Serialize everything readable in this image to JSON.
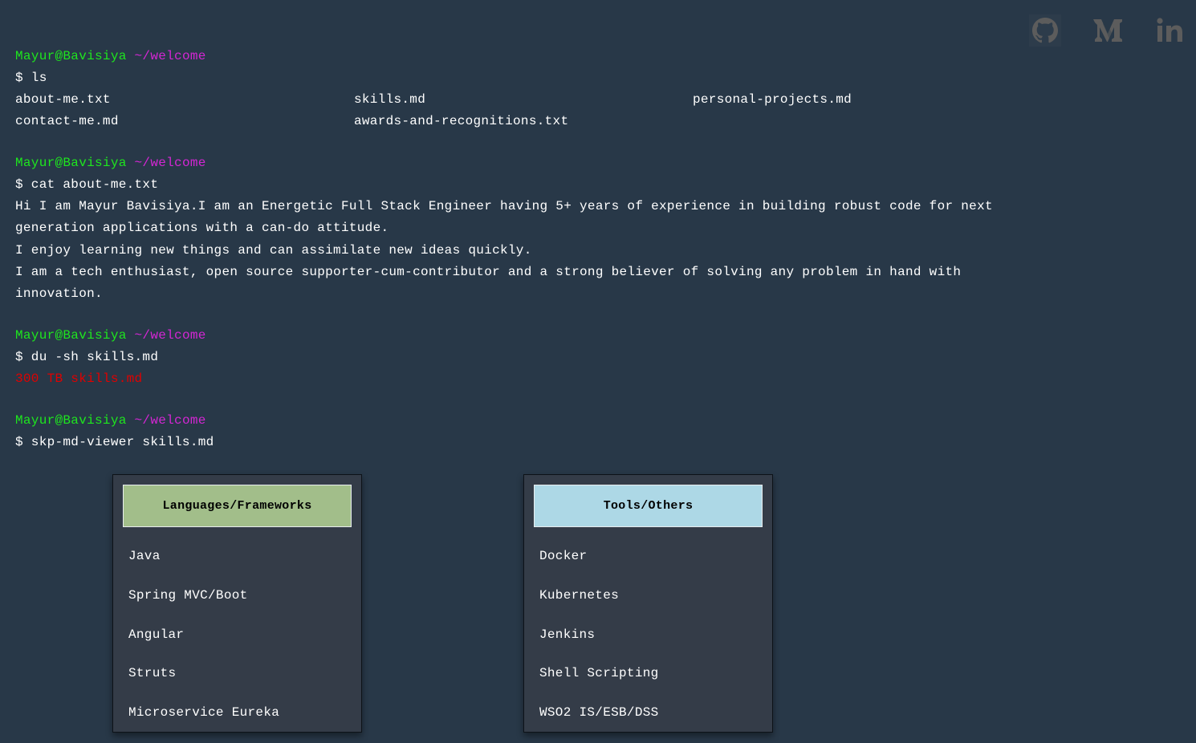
{
  "social": {
    "github_icon": "github-icon",
    "medium_icon": "medium-icon",
    "linkedin_icon": "linkedin-icon",
    "icon_color": "#5c5c5c"
  },
  "prompt": {
    "user": "Mayur@Bavisiya",
    "path": "~/welcome"
  },
  "commands": {
    "ls": "$ ls",
    "cat": "$ cat about-me.txt",
    "du": "$ du -sh skills.md",
    "viewer": "$ skp-md-viewer skills.md"
  },
  "files": [
    "about-me.txt",
    "skills.md",
    "personal-projects.md",
    "contact-me.md",
    "awards-and-recognitions.txt"
  ],
  "about": {
    "p1": "Hi I am Mayur Bavisiya.I am an Energetic Full Stack Engineer having 5+ years of experience in building robust code for next generation applications with a can-do attitude.",
    "p2": "I enjoy learning new things and can assimilate new ideas quickly.",
    "p3": "I am a tech enthusiast, open source supporter-cum-contributor and a strong believer of solving any problem in hand with innovation."
  },
  "du_output": "300 TB skills.md",
  "cards": {
    "languages": {
      "title": "Languages/Frameworks",
      "color": "#a2be8a",
      "items": [
        "Java",
        "Spring MVC/Boot",
        "Angular",
        "Struts",
        "Microservice Eureka"
      ]
    },
    "tools": {
      "title": "Tools/Others",
      "color": "#add8e6",
      "items": [
        "Docker",
        "Kubernetes",
        "Jenkins",
        "Shell Scripting",
        "WSO2 IS/ESB/DSS"
      ]
    }
  },
  "colors": {
    "background": "#283848",
    "prompt_user": "#1ee61e",
    "prompt_path": "#d426d4",
    "error": "#e00000"
  }
}
